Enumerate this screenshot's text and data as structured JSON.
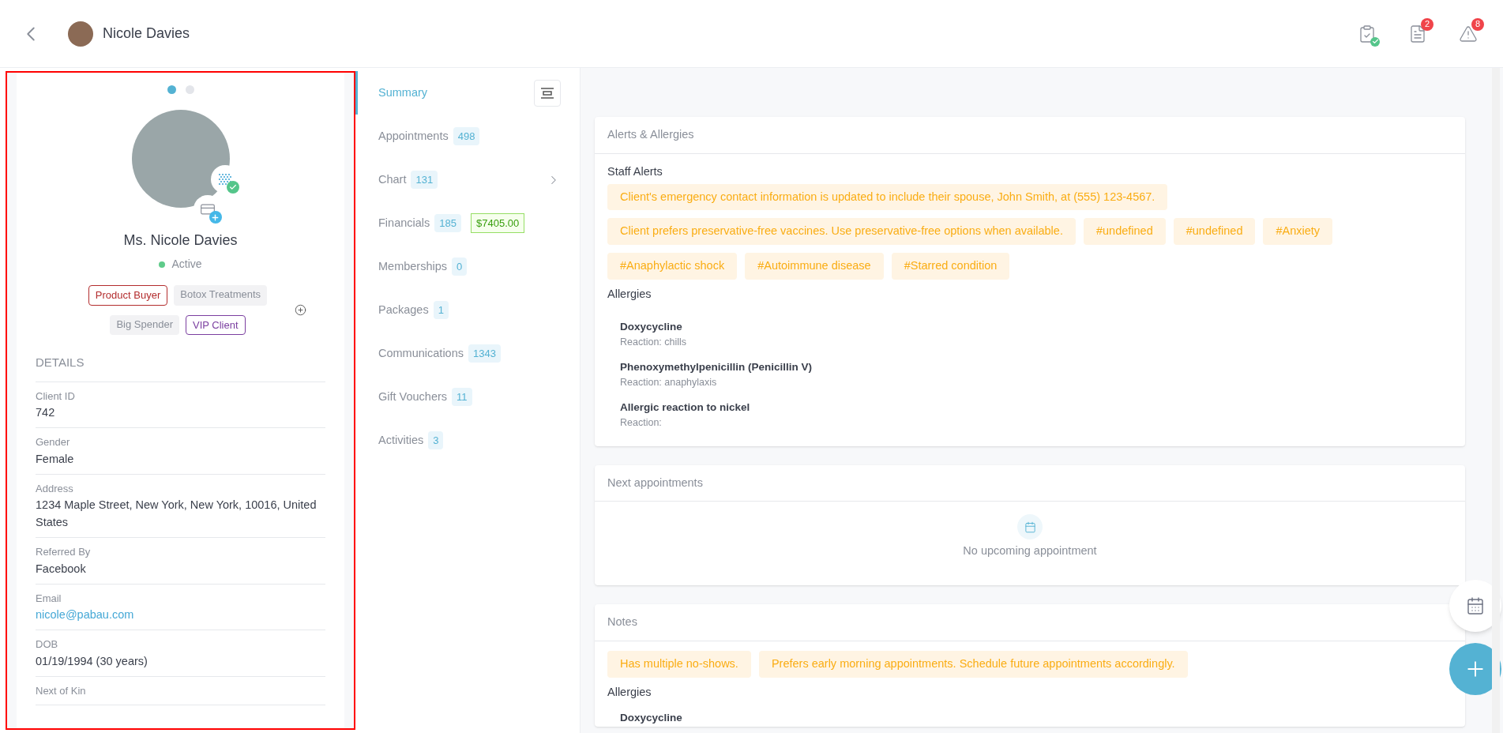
{
  "header": {
    "name": "Nicole Davies",
    "badges": [
      {
        "kind": "clipboard"
      },
      {
        "kind": "document",
        "count": "2"
      },
      {
        "kind": "warning",
        "count": "8"
      }
    ]
  },
  "profile": {
    "carousel": [
      {
        "selected": true
      },
      {
        "selected": false
      }
    ],
    "name": "Ms. Nicole Davies",
    "status": "Active",
    "tags": [
      {
        "label": "Product Buyer",
        "kind": "red"
      },
      {
        "label": "Botox Treatments",
        "kind": "plain"
      },
      {
        "label": "Big Spender",
        "kind": "plain"
      },
      {
        "label": "VIP Client",
        "kind": "purple"
      }
    ],
    "details_title": "DETAILS",
    "details": [
      {
        "label": "Client ID",
        "value": "742",
        "kind": "text"
      },
      {
        "label": "Gender",
        "value": "Female",
        "kind": "text"
      },
      {
        "label": "Address",
        "value": "1234 Maple Street, New York, New York, 10016, United States",
        "kind": "text"
      },
      {
        "label": "Referred By",
        "value": "Facebook",
        "kind": "text"
      },
      {
        "label": "Email",
        "value": "nicole@pabau.com",
        "kind": "link"
      },
      {
        "label": "DOB",
        "value": "01/19/1994 (30 years)",
        "kind": "text"
      },
      {
        "label": "Next of Kin",
        "kind": "text"
      }
    ]
  },
  "nav": [
    {
      "label": "Summary",
      "selected": true
    },
    {
      "label": "Appointments",
      "count": "498",
      "selected": false
    },
    {
      "label": "Chart",
      "count": "131",
      "selected": false,
      "expandable": true
    },
    {
      "label": "Financials",
      "count": "185",
      "amount": "$7405.00",
      "selected": false
    },
    {
      "label": "Memberships",
      "count": "0",
      "selected": false
    },
    {
      "label": "Packages",
      "count": "1",
      "selected": false
    },
    {
      "label": "Communications",
      "count": "1343",
      "selected": false
    },
    {
      "label": "Gift Vouchers",
      "count": "11",
      "selected": false
    },
    {
      "label": "Activities",
      "count": "3",
      "selected": false
    }
  ],
  "alerts_card": {
    "title": "Alerts & Allergies",
    "staff_alerts_title": "Staff Alerts",
    "alerts": [
      "Client's emergency contact information is updated to include their spouse, John Smith, at (555) 123-4567.",
      "Client prefers preservative-free vaccines. Use preservative-free options when available.",
      "#undefined",
      "#undefined",
      "#Anxiety",
      "#Anaphylactic shock",
      "#Autoimmune disease",
      "#Starred condition"
    ],
    "allergies_title": "Allergies",
    "allergies": [
      {
        "name": "Doxycycline",
        "reaction": "Reaction: chills"
      },
      {
        "name": "Phenoxymethylpenicillin (Penicillin V)",
        "reaction": "Reaction: anaphylaxis"
      },
      {
        "name": "Allergic reaction to nickel",
        "reaction": "Reaction:"
      }
    ]
  },
  "appointments_card": {
    "title": "Next appointments",
    "empty": "No upcoming appointment"
  },
  "notes_card": {
    "title": "Notes",
    "notes": [
      "Has multiple no-shows.",
      "Prefers early morning appointments. Schedule future appointments accordingly."
    ],
    "allergies_title": "Allergies",
    "allergies": [
      {
        "name": "Doxycycline"
      }
    ]
  }
}
